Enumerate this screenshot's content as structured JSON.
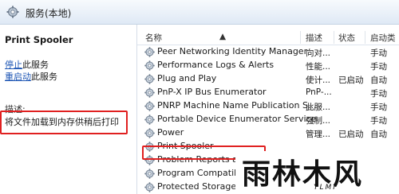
{
  "header": {
    "title": "服务(本地)",
    "icon": "services-gear-icon"
  },
  "left_pane": {
    "service_name": "Print Spooler",
    "actions": [
      {
        "link": "停止",
        "suffix": "此服务"
      },
      {
        "link": "重启动",
        "suffix": "此服务"
      }
    ],
    "description_label": "描述:",
    "description_text": "将文件加载到内存供稍后打印"
  },
  "columns": {
    "name": "名称",
    "description": "描述",
    "status": "状态",
    "startup": "启动类"
  },
  "rows": [
    {
      "name": "Peer Networking Identity Manager",
      "description": "向对...",
      "status": "",
      "startup": "手动"
    },
    {
      "name": "Performance Logs & Alerts",
      "description": "性能...",
      "status": "",
      "startup": "手动"
    },
    {
      "name": "Plug and Play",
      "description": "使计...",
      "status": "已启动",
      "startup": "自动"
    },
    {
      "name": "PnP-X IP Bus Enumerator",
      "description": "PnP-...",
      "status": "",
      "startup": "手动"
    },
    {
      "name": "PNRP Machine Name Publication S...",
      "description": "此服...",
      "status": "",
      "startup": "手动"
    },
    {
      "name": "Portable Device Enumerator Service",
      "description": "强制...",
      "status": "",
      "startup": "手动"
    },
    {
      "name": "Power",
      "description": "管理...",
      "status": "已启动",
      "startup": "自动"
    },
    {
      "name": "Print Spooler",
      "description": "",
      "status": "",
      "startup": ""
    },
    {
      "name": "Problem Reports and",
      "description": "",
      "status": "",
      "startup": ""
    },
    {
      "name": "Program Compatibil",
      "description": "",
      "status": "",
      "startup": ""
    },
    {
      "name": "Protected Storage",
      "description": "",
      "status": "",
      "startup": ""
    }
  ],
  "highlight_color": "#e02020",
  "watermark": {
    "main": "雨林木风",
    "sub": "YLMF"
  }
}
